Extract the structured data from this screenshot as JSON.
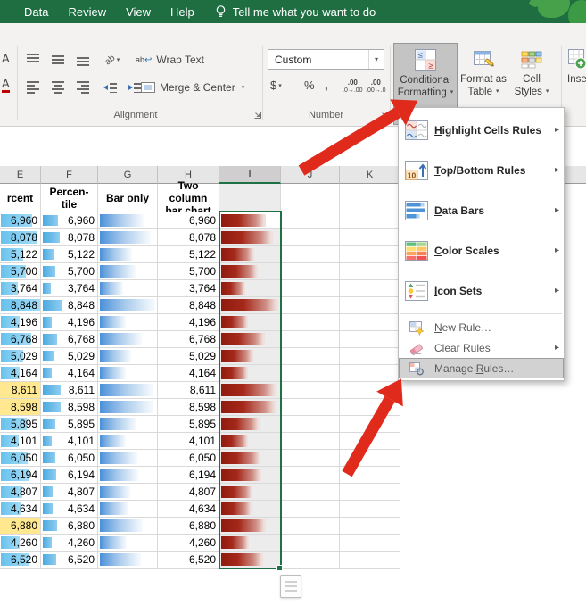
{
  "titlebar": {
    "tabs": [
      {
        "label": "Data"
      },
      {
        "label": "Review"
      },
      {
        "label": "View"
      },
      {
        "label": "Help"
      }
    ],
    "tell_me": "Tell me what you want to do"
  },
  "ribbon": {
    "alignment": {
      "wrap_text": "Wrap Text",
      "merge_center": "Merge & Center",
      "group_label": "Alignment"
    },
    "number": {
      "format_value": "Custom",
      "currency": "$",
      "percent": "%",
      "comma": ",",
      "increase_decimal": ".0→.00",
      "decrease_decimal": ".00→.0",
      "group_label": "Number"
    },
    "styles": {
      "buttons": [
        {
          "l1": "Conditional",
          "l2": "Formatting"
        },
        {
          "l1": "Format as",
          "l2": "Table"
        },
        {
          "l1": "Cell",
          "l2": "Styles"
        }
      ],
      "insert_partial": "Inse"
    }
  },
  "menu": {
    "items": [
      {
        "label": "Highlight Cells Rules",
        "access_key_index": 0,
        "has_submenu": true
      },
      {
        "label": "Top/Bottom Rules",
        "access_key_index": 0,
        "has_submenu": true
      },
      {
        "label": "Data Bars",
        "access_key_index": 0,
        "has_submenu": true
      },
      {
        "label": "Color Scales",
        "access_key_index": 0,
        "has_submenu": true
      },
      {
        "label": "Icon Sets",
        "access_key_index": 0,
        "has_submenu": true
      },
      {
        "label": "New Rule…",
        "access_key_index": 0,
        "has_submenu": false
      },
      {
        "label": "Clear Rules",
        "access_key_index": 0,
        "has_submenu": true
      },
      {
        "label": "Manage Rules…",
        "access_key_index": 7,
        "has_submenu": false,
        "highlighted": true
      }
    ]
  },
  "sheet": {
    "column_letters": [
      "E",
      "F",
      "G",
      "H",
      "I",
      "J",
      "K"
    ],
    "selected_column": "I",
    "headers": {
      "e": "rcent",
      "f": "Percen-\ntile",
      "g": "Bar only",
      "h": "Two column\nbar chart"
    },
    "values": [
      6960,
      8078,
      5122,
      5700,
      3764,
      8848,
      4196,
      6768,
      5029,
      4164,
      8611,
      8598,
      5895,
      4101,
      6050,
      6194,
      4807,
      4634,
      6880,
      4260,
      6520
    ],
    "yellow_rows": [
      10,
      11,
      18
    ]
  },
  "colors": {
    "excel_green": "#1e6e42",
    "arrow_red": "#e02a1c",
    "bar_blue": "#4a90d8",
    "bar_red": "#8f1b0e",
    "selection_green": "#1e7145",
    "yellow_highlight": "#ffe88f"
  }
}
